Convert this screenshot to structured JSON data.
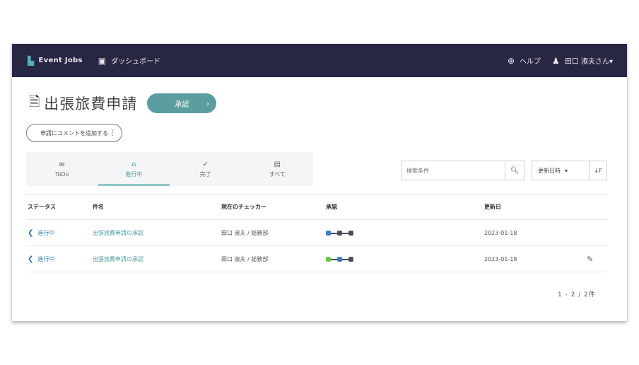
{
  "navbar": {
    "brand": "Event Jobs",
    "dashboard_label": "ダッシュボード",
    "help_label": "ヘルプ",
    "user_label": "田口 淑夫さん▾"
  },
  "page": {
    "title": "出張旅費申請",
    "status_label": "承認",
    "secondary_button": "申請にコメントを追加する"
  },
  "tabs": [
    {
      "label": "ToDo",
      "icon": "inbox-icon"
    },
    {
      "label": "進行中",
      "icon": "home-icon"
    },
    {
      "label": "完了",
      "icon": "check-icon"
    },
    {
      "label": "すべて",
      "icon": "archive-icon"
    }
  ],
  "search": {
    "placeholder": "検索条件"
  },
  "sort": {
    "label": "更新日時",
    "order": "↓F"
  },
  "table": {
    "headers": [
      "ステータス",
      "件名",
      "現在のチェッカー",
      "承認",
      "更新日"
    ],
    "rows": [
      {
        "status": "進行中",
        "subject": "出張旅費申請の承認",
        "checker": "田口 淑夫 / 総務部",
        "updated": "2023-01-18",
        "flow": [
          "blue",
          "dark",
          "dark"
        ],
        "attachment": ""
      },
      {
        "status": "進行中",
        "subject": "出張旅費申請の承認",
        "checker": "田口 淑夫 / 総務部",
        "updated": "2023-01-18",
        "flow": [
          "green",
          "blue",
          "dark"
        ],
        "attachment": "paperclip-icon"
      }
    ]
  },
  "pagination": "1 - 2 / 2件"
}
